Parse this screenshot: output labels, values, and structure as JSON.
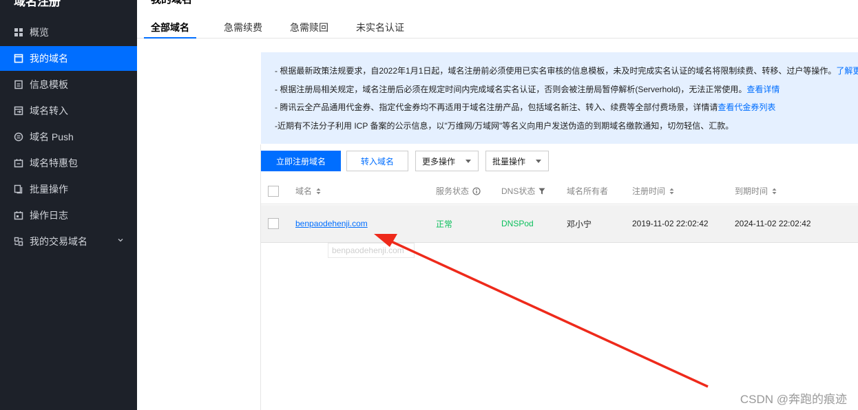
{
  "sidebar": {
    "title": "域名注册",
    "items": [
      {
        "label": "概览",
        "icon": "grid-icon"
      },
      {
        "label": "我的域名",
        "icon": "window-icon",
        "active": true
      },
      {
        "label": "信息模板",
        "icon": "document-icon"
      },
      {
        "label": "域名转入",
        "icon": "transfer-icon"
      },
      {
        "label": "域名 Push",
        "icon": "push-icon"
      },
      {
        "label": "域名特惠包",
        "icon": "calendar-icon"
      },
      {
        "label": "批量操作",
        "icon": "copy-icon"
      },
      {
        "label": "操作日志",
        "icon": "log-icon"
      },
      {
        "label": "我的交易域名",
        "icon": "trade-icon"
      }
    ]
  },
  "header": {
    "title": "我的域名",
    "tabs": [
      "全部域名",
      "急需续费",
      "急需赎回",
      "未实名认证"
    ]
  },
  "notice": {
    "line1": "- 根据最新政策法规要求，自2022年1月1日起，域名注册前必须使用已实名审核的信息模板，未及时完成实名认证的域名将限制续费、转移、过户等操作。",
    "line1_link": "了解更",
    "line2": "- 根据注册局相关规定，域名注册后必须在规定时间内完成域名实名认证，否则会被注册局暂停解析(Serverhold)，无法正常使用。",
    "line2_link": "查看详情",
    "line3": "- 腾讯云全产品通用代金券、指定代金券均不再适用于域名注册产品，包括域名新注、转入、续费等全部付费场景，详情请",
    "line3_link": "查看代金券列表",
    "line4": "-近期有不法分子利用 ICP 备案的公示信息，以\"万维网/万域网\"等名义向用户发送伪造的到期域名缴款通知，切勿轻信、汇款。"
  },
  "actions": {
    "register": "立即注册域名",
    "transfer_in": "转入域名",
    "more": "更多操作",
    "batch": "批量操作"
  },
  "table": {
    "headers": {
      "domain": "域名",
      "service_status": "服务状态",
      "dns_status": "DNS状态",
      "owner": "域名所有者",
      "reg_time": "注册时间",
      "exp_time": "到期时间"
    },
    "rows": [
      {
        "domain": "benpaodehenji.com",
        "service_status": "正常",
        "dns_status": "DNSPod",
        "owner": "邓小宁",
        "reg_time": "2019-11-02 22:02:42",
        "exp_time": "2024-11-02 22:02:42"
      }
    ]
  },
  "tooltip": "benpaodehenji.com",
  "watermark": "CSDN @奔跑的痕迹",
  "colors": {
    "sidebar_bg": "#1d2129",
    "accent": "#006eff",
    "notice_bg": "#e5f0ff",
    "status_ok": "#0abf5b",
    "arrow": "#ee2a1b"
  }
}
